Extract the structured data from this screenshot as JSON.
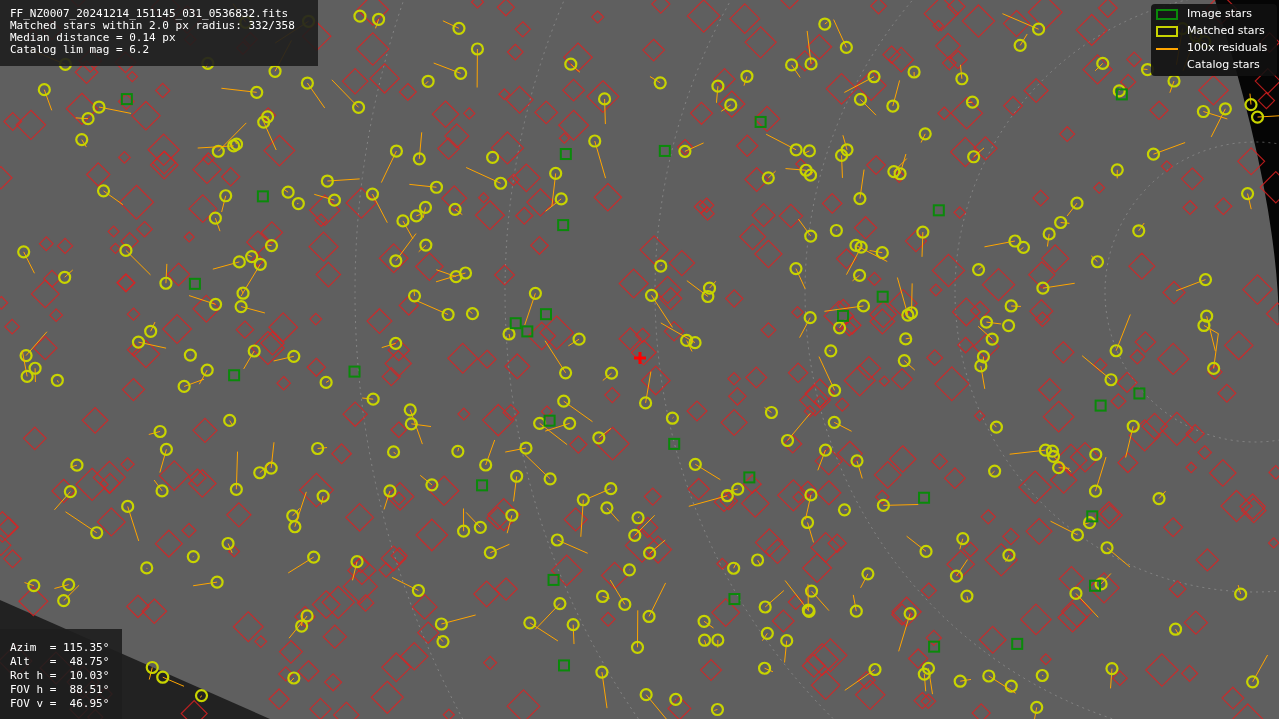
{
  "header": {
    "lines": [
      "FF_NZ0007_20241214_151145_031_0536832.fits",
      "Matched stars within 2.0 px radius: 332/358",
      "Median distance = 0.14 px",
      "Catalog lim mag = 6.2"
    ]
  },
  "legend": [
    {
      "kind": "image",
      "label": "Image stars"
    },
    {
      "kind": "matched",
      "label": "Matched stars"
    },
    {
      "kind": "residual",
      "label": "100x residuals"
    },
    {
      "kind": "catalog",
      "label": "Catalog stars"
    }
  ],
  "pointing": {
    "lines": [
      "Azim  = 115.35°",
      "Alt   =  48.75°",
      "Rot h =  10.03°",
      "FOV h =  88.51°",
      "FOV v =  46.95°"
    ]
  }
}
